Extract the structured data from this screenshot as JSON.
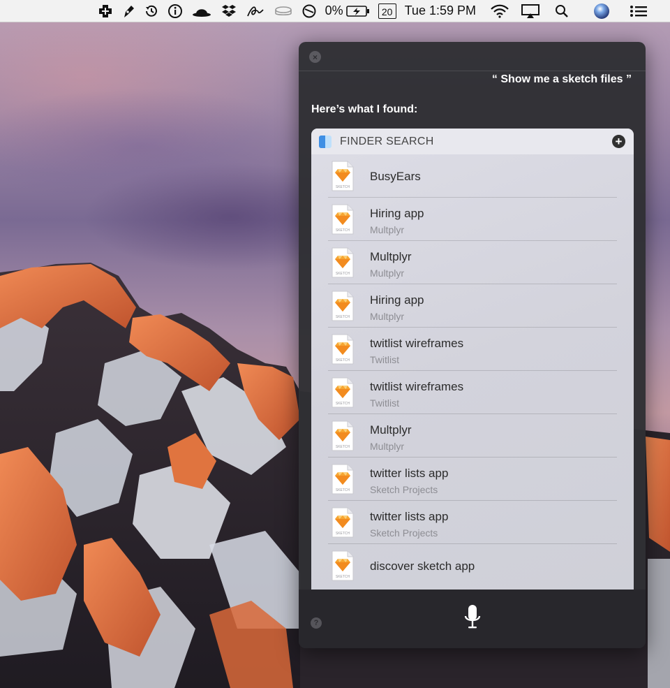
{
  "menubar": {
    "icons": [
      "first-aid-icon",
      "pen-icon",
      "time-machine-icon",
      "info-icon",
      "bowler-hat-icon",
      "dropbox-icon",
      "signature-icon",
      "cloud-drive-icon",
      "blocked-icon",
      "battery-icon",
      "calendar-icon",
      "wifi-icon",
      "airplay-icon",
      "spotlight-search-icon",
      "siri-icon",
      "notification-center-icon"
    ],
    "battery_percent": "0%",
    "calendar_day": "20",
    "clock": "Tue 1:59 PM"
  },
  "siri": {
    "close_symbol": "×",
    "query": "“ Show me a sketch files ”",
    "heading": "Here’s what I found:",
    "card": {
      "title": "FINDER SEARCH",
      "add_symbol": "+",
      "file_type_label": "SKETCH",
      "results": [
        {
          "name": "BusyEars",
          "sub": ""
        },
        {
          "name": "Hiring app",
          "sub": "Multplyr"
        },
        {
          "name": "Multplyr",
          "sub": "Multplyr"
        },
        {
          "name": "Hiring app",
          "sub": "Multplyr"
        },
        {
          "name": "twitlist wireframes",
          "sub": "Twitlist"
        },
        {
          "name": "twitlist wireframes",
          "sub": "Twitlist"
        },
        {
          "name": "Multplyr",
          "sub": "Multplyr"
        },
        {
          "name": "twitter lists app",
          "sub": "Sketch Projects"
        },
        {
          "name": "twitter lists app",
          "sub": "Sketch Projects"
        },
        {
          "name": "discover sketch app",
          "sub": ""
        }
      ]
    },
    "help_symbol": "?",
    "mic_icon": "microphone-icon"
  },
  "colors": {
    "panel_bg": "#302f34",
    "card_bg": "#d6d6de",
    "sketch_orange": "#f7a531",
    "finder_blue": "#3f8fe4"
  }
}
